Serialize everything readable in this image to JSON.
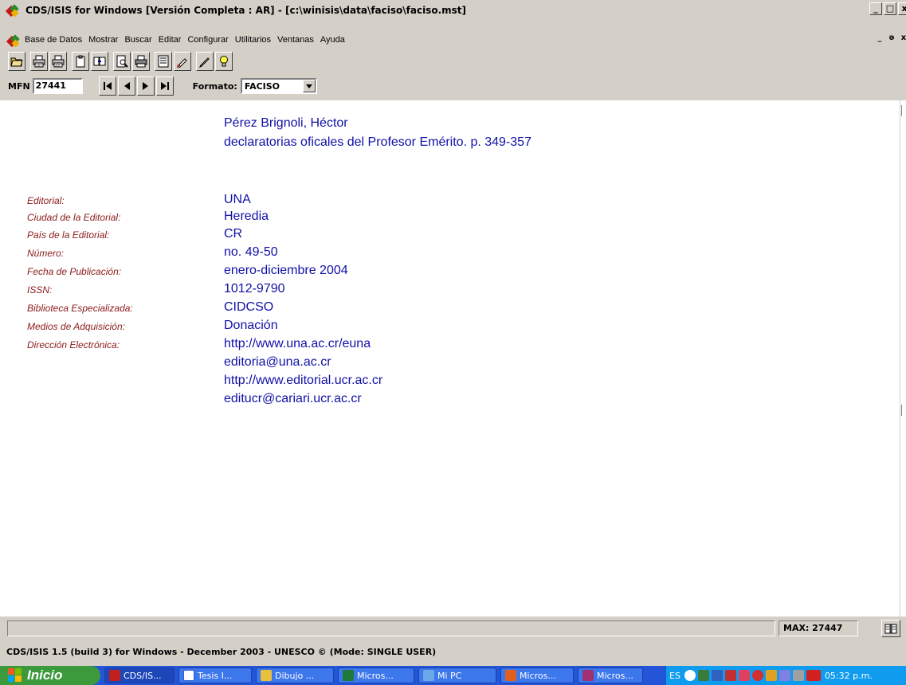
{
  "window": {
    "title": "CDS/ISIS for Windows [Versión Completa : AR] - [c:\\winisis\\data\\faciso\\faciso.mst]",
    "caption_minimize": "_",
    "caption_maximize": "□",
    "caption_close": "x",
    "mdi_minimize": "_",
    "mdi_restore": "ǝ",
    "mdi_close": "x"
  },
  "menu": {
    "items": [
      "Base de Datos",
      "Mostrar",
      "Buscar",
      "Editar",
      "Configurar",
      "Utilitarios",
      "Ventanas",
      "Ayuda"
    ]
  },
  "toolbar": {
    "icons": [
      "open-folder-icon",
      "print-txt-icon",
      "print-rtf-icon",
      "clipboard-icon",
      "copy-paste-icon",
      "print-preview-icon",
      "printer-icon",
      "form-icon",
      "edit-record-icon",
      "pencil-icon",
      "lightbulb-icon"
    ]
  },
  "navigation": {
    "mfn_label": "MFN",
    "mfn_value": "27441",
    "formato_label": "Formato:",
    "formato_value": "FACISO"
  },
  "record": {
    "author": "Pérez Brignoli, Héctor",
    "title_line": "declaratorias oficales del Profesor Emérito. p. 349-357",
    "fields": [
      {
        "label": "Editorial:",
        "value": "UNA"
      },
      {
        "label": "Ciudad de la Editorial:",
        "value": "Heredia"
      },
      {
        "label": "País de la Editorial:",
        "value": "CR"
      },
      {
        "label": "Número:",
        "value": "no. 49-50"
      },
      {
        "label": "Fecha de Publicación:",
        "value": "enero-diciembre 2004"
      },
      {
        "label": "ISSN:",
        "value": "1012-9790"
      },
      {
        "label": "Biblioteca Especializada:",
        "value": "CIDCSO"
      },
      {
        "label": "Medios de Adquisición:",
        "value": "Donación"
      },
      {
        "label": "Dirección Electrónica:",
        "value": "http://www.una.ac.cr/euna"
      }
    ],
    "extra_lines": [
      "editoria@una.ac.cr",
      "http://www.editorial.ucr.ac.cr",
      "editucr@cariari.ucr.ac.cr"
    ]
  },
  "status": {
    "max_text": "MAX: 27447",
    "info_line": "CDS/ISIS 1.5 (build 3) for Windows - December 2003 - UNESCO © (Mode: SINGLE USER)"
  },
  "taskbar": {
    "start_label": "Inicio",
    "tasks": [
      "CDS/IS...",
      "Tesis I...",
      "Dibujo ...",
      "Micros...",
      "Mi PC",
      "Micros...",
      "Micros..."
    ],
    "lang": "ES",
    "time": "05:32 p.m."
  }
}
